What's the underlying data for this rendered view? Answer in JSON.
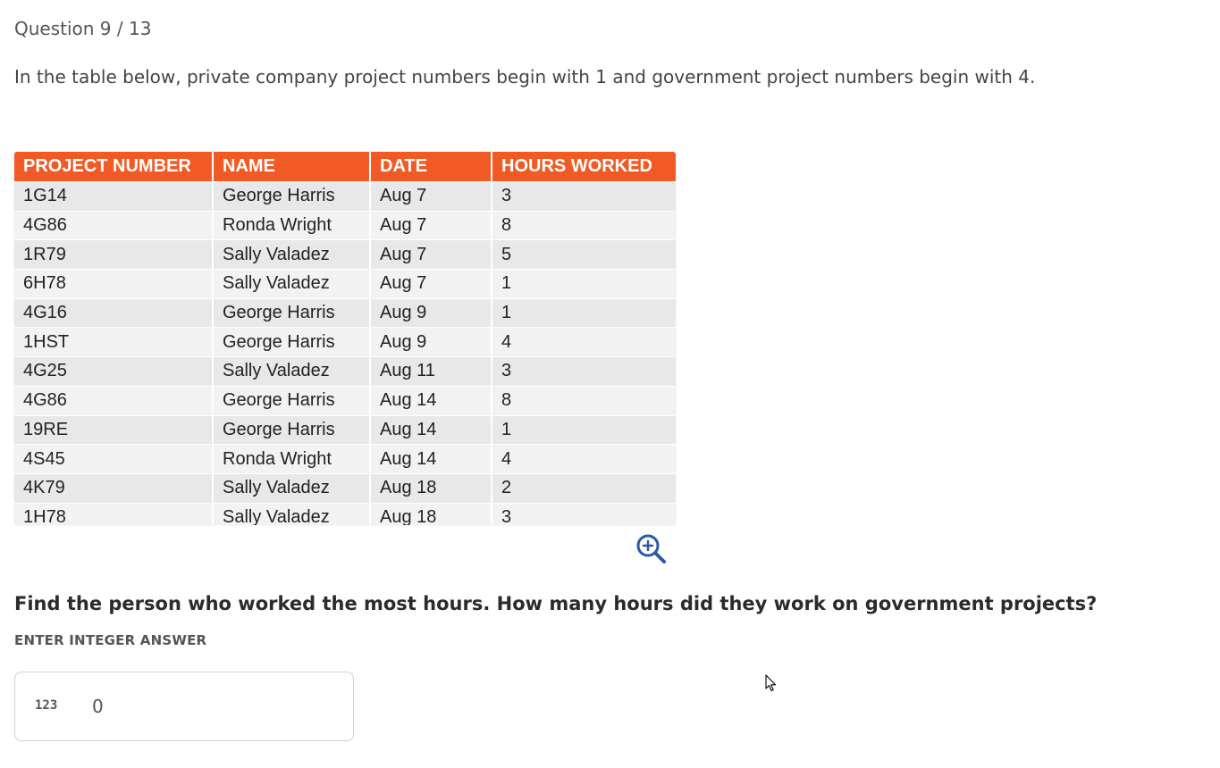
{
  "question": {
    "counter": "Question 9 / 13",
    "intro": "In the table below, private company project numbers begin with 1 and government project numbers begin with 4.",
    "prompt": "Find the person who worked the most hours. How many hours did they work on government projects?"
  },
  "table": {
    "headers": [
      "PROJECT NUMBER",
      "NAME",
      "DATE",
      "HOURS WORKED"
    ],
    "rows": [
      [
        "1G14",
        "George Harris",
        "Aug 7",
        "3"
      ],
      [
        "4G86",
        "Ronda Wright",
        "Aug 7",
        "8"
      ],
      [
        "1R79",
        "Sally Valadez",
        "Aug 7",
        "5"
      ],
      [
        "6H78",
        "Sally Valadez",
        "Aug 7",
        "1"
      ],
      [
        "4G16",
        "George Harris",
        "Aug 9",
        "1"
      ],
      [
        "1HST",
        "George Harris",
        "Aug 9",
        "4"
      ],
      [
        "4G25",
        "Sally Valadez",
        "Aug 11",
        "3"
      ],
      [
        "4G86",
        "George Harris",
        "Aug 14",
        "8"
      ],
      [
        "19RE",
        "George Harris",
        "Aug 14",
        "1"
      ],
      [
        "4S45",
        "Ronda Wright",
        "Aug 14",
        "4"
      ],
      [
        "4K79",
        "Sally Valadez",
        "Aug 18",
        "2"
      ],
      [
        "1H78",
        "Sally Valadez",
        "Aug 18",
        "3"
      ]
    ],
    "header_color": "#f15a24",
    "zoom_icon": "zoom-in-icon"
  },
  "answer": {
    "label": "ENTER INTEGER ANSWER",
    "icon_text": "123",
    "value": "0"
  },
  "colors": {
    "accent": "#f15a24",
    "zoom_icon": "#2a5aa8"
  }
}
